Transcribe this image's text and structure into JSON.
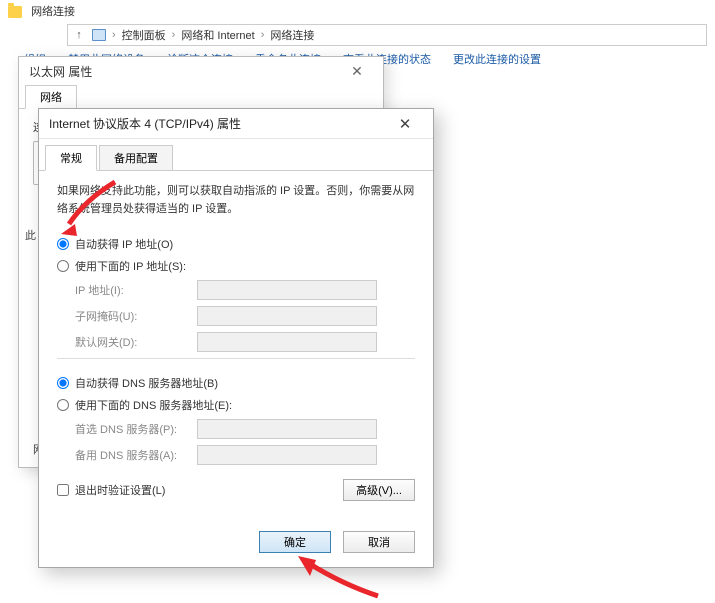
{
  "explorer": {
    "windowLabel": "网络连接",
    "breadcrumb": {
      "control_panel": "控制面板",
      "net_internet": "网络和 Internet",
      "net_conn": "网络连接"
    },
    "toolbar": {
      "menu": "组织",
      "disable": "禁用此网络设备",
      "diagnose": "诊断这个连接",
      "rename": "重命名此连接",
      "status": "查看此连接的状态",
      "change": "更改此连接的设置"
    }
  },
  "ethDialog": {
    "title": "以太网 属性",
    "tabNetwork": "网络",
    "connectUsing": "连接时使用:",
    "sideLetter": "此",
    "itemsLabel": "网"
  },
  "ipv4Dialog": {
    "title": "Internet 协议版本 4 (TCP/IPv4) 属性",
    "tabGeneral": "常规",
    "tabAlternate": "备用配置",
    "description": "如果网络支持此功能，则可以获取自动指派的 IP 设置。否则，你需要从网络系统管理员处获得适当的 IP 设置。",
    "ip_auto": "自动获得 IP 地址(O)",
    "ip_manual": "使用下面的 IP 地址(S):",
    "ip_label": "IP 地址(I):",
    "mask_label": "子网掩码(U):",
    "gw_label": "默认网关(D):",
    "dns_auto": "自动获得 DNS 服务器地址(B)",
    "dns_manual": "使用下面的 DNS 服务器地址(E):",
    "dns_pref": "首选 DNS 服务器(P):",
    "dns_alt": "备用 DNS 服务器(A):",
    "validate": "退出时验证设置(L)",
    "advanced": "高级(V)...",
    "ok": "确定",
    "cancel": "取消"
  }
}
